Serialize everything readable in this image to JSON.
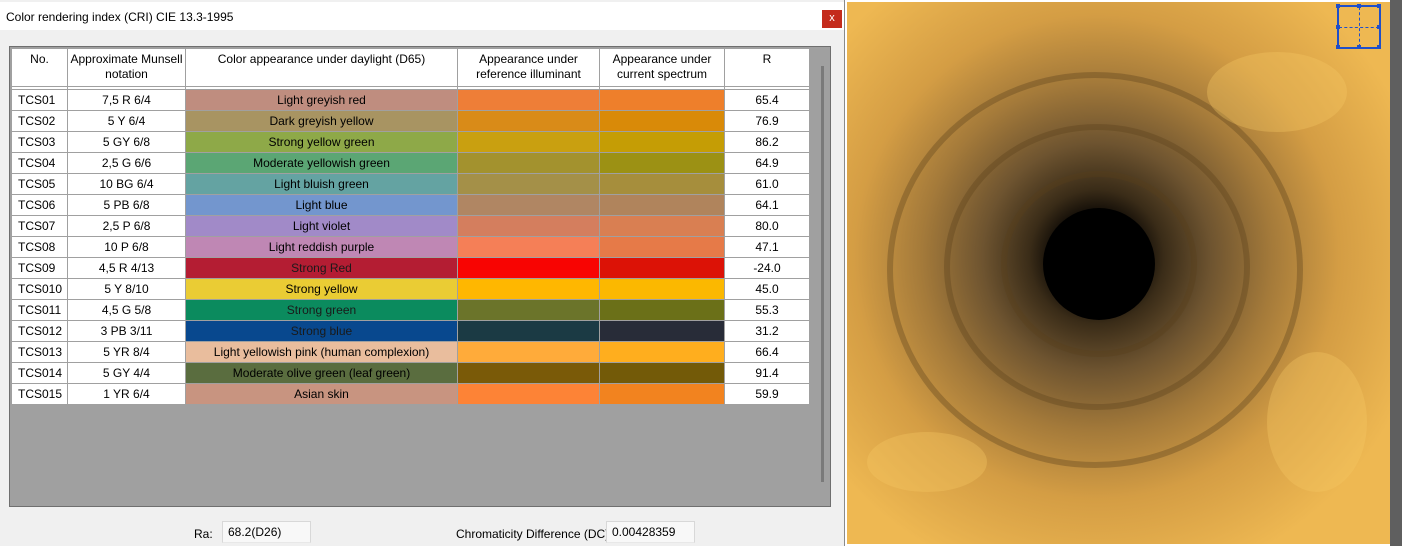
{
  "dialog": {
    "title": "Color rendering index (CRI) CIE 13.3-1995",
    "close_glyph": "x"
  },
  "table": {
    "headers": {
      "no": "No.",
      "munsell": "Approximate Munsell notation",
      "daylight": "Color appearance under daylight (D65)",
      "reference": "Appearance under reference illuminant",
      "current": "Appearance under current spectrum",
      "r": "R"
    },
    "rows": [
      {
        "no": "TCS01",
        "munsell": "7,5 R 6/4",
        "name": "Light greyish red",
        "d65": "#bf8d7f",
        "ref": "#ee7e37",
        "cur": "#ee7f2b",
        "text": "#000000",
        "r": "65.4"
      },
      {
        "no": "TCS02",
        "munsell": "5 Y 6/4",
        "name": "Dark greyish yellow",
        "d65": "#a89462",
        "ref": "#d98b18",
        "cur": "#d98a08",
        "text": "#000000",
        "r": "76.9"
      },
      {
        "no": "TCS03",
        "munsell": "5 GY 6/8",
        "name": "Strong yellow green",
        "d65": "#8ea948",
        "ref": "#c9a010",
        "cur": "#c59d05",
        "text": "#000000",
        "r": "86.2"
      },
      {
        "no": "TCS04",
        "munsell": "2,5 G 6/6",
        "name": "Moderate yellowish green",
        "d65": "#5ba674",
        "ref": "#a3922e",
        "cur": "#9c9114",
        "text": "#000000",
        "r": "64.9"
      },
      {
        "no": "TCS05",
        "munsell": "10 BG 6/4",
        "name": "Light bluish green",
        "d65": "#64a3a2",
        "ref": "#a49048",
        "cur": "#a68e3c",
        "text": "#000000",
        "r": "61.0"
      },
      {
        "no": "TCS06",
        "munsell": "5 PB 6/8",
        "name": "Light blue",
        "d65": "#7396ce",
        "ref": "#b08663",
        "cur": "#b0845c",
        "text": "#000000",
        "r": "64.1"
      },
      {
        "no": "TCS07",
        "munsell": "2,5 P 6/8",
        "name": "Light violet",
        "d65": "#a18ac8",
        "ref": "#d47e5e",
        "cur": "#d97f52",
        "text": "#000000",
        "r": "80.0"
      },
      {
        "no": "TCS08",
        "munsell": "10 P 6/8",
        "name": "Light reddish purple",
        "d65": "#bf87b4",
        "ref": "#f57f57",
        "cur": "#e67a48",
        "text": "#000000",
        "r": "47.1"
      },
      {
        "no": "TCS09",
        "munsell": "4,5 R 4/13",
        "name": "Strong Red",
        "d65": "#b41d33",
        "ref": "#f80402",
        "cur": "#dc1206",
        "text": "#1a1a1a",
        "r": "-24.0"
      },
      {
        "no": "TCS010",
        "munsell": "5 Y 8/10",
        "name": "Strong yellow",
        "d65": "#eacc34",
        "ref": "#ffb700",
        "cur": "#fbb800",
        "text": "#000000",
        "r": "45.0"
      },
      {
        "no": "TCS011",
        "munsell": "4,5 G 5/8",
        "name": "Strong green",
        "d65": "#0b8b5e",
        "ref": "#6b742a",
        "cur": "#6b7018",
        "text": "#1a1a1a",
        "r": "55.3"
      },
      {
        "no": "TCS012",
        "munsell": "3 PB 3/11",
        "name": "Strong blue",
        "d65": "#08488e",
        "ref": "#1b3a44",
        "cur": "#282c38",
        "text": "#1a1a1a",
        "r": "31.2"
      },
      {
        "no": "TCS013",
        "munsell": "5 YR 8/4",
        "name": "Light yellowish pink (human complexion)",
        "d65": "#e9bd9d",
        "ref": "#ffab3a",
        "cur": "#ffae1e",
        "text": "#000000",
        "r": "66.4"
      },
      {
        "no": "TCS014",
        "munsell": "5 GY 4/4",
        "name": "Moderate olive green (leaf green)",
        "d65": "#5a6d3f",
        "ref": "#7a5a08",
        "cur": "#735a08",
        "text": "#000000",
        "r": "91.4"
      },
      {
        "no": "TCS015",
        "munsell": "1 YR 6/4",
        "name": "Asian skin",
        "d65": "#c89480",
        "ref": "#fd8336",
        "cur": "#f2831f",
        "text": "#000000",
        "r": "59.9"
      }
    ]
  },
  "footer": {
    "ra_label": "Ra:",
    "ra_value": "68.2(D26)",
    "dc_label": "Chromaticity Difference (DC):",
    "dc_value": "0.00428359"
  },
  "viewer": {
    "image": "tunnel-render"
  }
}
